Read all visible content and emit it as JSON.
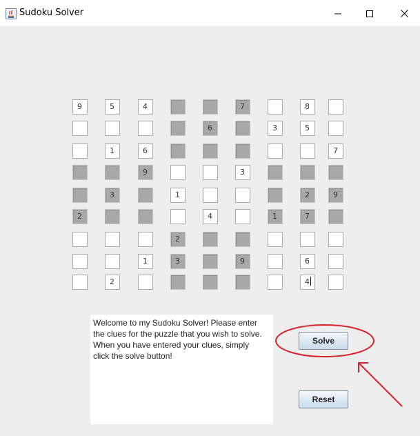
{
  "window": {
    "title": "Sudoku Solver",
    "icon": "java-app-icon",
    "controls": [
      "minimize-icon",
      "maximize-icon",
      "close-icon"
    ]
  },
  "grid": [
    [
      {
        "v": "9",
        "g": false
      },
      {
        "v": "5",
        "g": false
      },
      {
        "v": "4",
        "g": false
      },
      {
        "v": "",
        "g": true
      },
      {
        "v": "",
        "g": true
      },
      {
        "v": "7",
        "g": true
      },
      {
        "v": "",
        "g": false
      },
      {
        "v": "8",
        "g": false
      },
      {
        "v": "",
        "g": false
      }
    ],
    [
      {
        "v": "",
        "g": false
      },
      {
        "v": "",
        "g": false
      },
      {
        "v": "",
        "g": false
      },
      {
        "v": "",
        "g": true
      },
      {
        "v": "6",
        "g": true
      },
      {
        "v": "",
        "g": true
      },
      {
        "v": "3",
        "g": false
      },
      {
        "v": "5",
        "g": false
      },
      {
        "v": "",
        "g": false
      }
    ],
    [
      {
        "v": "",
        "g": false
      },
      {
        "v": "1",
        "g": false
      },
      {
        "v": "6",
        "g": false
      },
      {
        "v": "",
        "g": true
      },
      {
        "v": "",
        "g": true
      },
      {
        "v": "",
        "g": true
      },
      {
        "v": "",
        "g": false
      },
      {
        "v": "",
        "g": false
      },
      {
        "v": "7",
        "g": false
      }
    ],
    [
      {
        "v": "",
        "g": true
      },
      {
        "v": "",
        "g": true
      },
      {
        "v": "9",
        "g": true
      },
      {
        "v": "",
        "g": false
      },
      {
        "v": "",
        "g": false
      },
      {
        "v": "3",
        "g": false
      },
      {
        "v": "",
        "g": true
      },
      {
        "v": "",
        "g": true
      },
      {
        "v": "",
        "g": true
      }
    ],
    [
      {
        "v": "",
        "g": true
      },
      {
        "v": "3",
        "g": true
      },
      {
        "v": "",
        "g": true
      },
      {
        "v": "1",
        "g": false
      },
      {
        "v": "",
        "g": false
      },
      {
        "v": "",
        "g": false
      },
      {
        "v": "",
        "g": true
      },
      {
        "v": "2",
        "g": true
      },
      {
        "v": "9",
        "g": true
      }
    ],
    [
      {
        "v": "2",
        "g": true
      },
      {
        "v": "",
        "g": true
      },
      {
        "v": "",
        "g": true
      },
      {
        "v": "",
        "g": false
      },
      {
        "v": "4",
        "g": false
      },
      {
        "v": "",
        "g": false
      },
      {
        "v": "1",
        "g": true
      },
      {
        "v": "7",
        "g": true
      },
      {
        "v": "",
        "g": true
      }
    ],
    [
      {
        "v": "",
        "g": false
      },
      {
        "v": "",
        "g": false
      },
      {
        "v": "",
        "g": false
      },
      {
        "v": "2",
        "g": true
      },
      {
        "v": "",
        "g": true
      },
      {
        "v": "",
        "g": true
      },
      {
        "v": "",
        "g": false
      },
      {
        "v": "",
        "g": false
      },
      {
        "v": "",
        "g": false
      }
    ],
    [
      {
        "v": "",
        "g": false
      },
      {
        "v": "",
        "g": false
      },
      {
        "v": "1",
        "g": false
      },
      {
        "v": "3",
        "g": true
      },
      {
        "v": "",
        "g": true
      },
      {
        "v": "9",
        "g": true
      },
      {
        "v": "",
        "g": false
      },
      {
        "v": "6",
        "g": false
      },
      {
        "v": "",
        "g": false
      }
    ],
    [
      {
        "v": "",
        "g": false
      },
      {
        "v": "2",
        "g": false
      },
      {
        "v": "",
        "g": false
      },
      {
        "v": "",
        "g": true
      },
      {
        "v": "",
        "g": true
      },
      {
        "v": "",
        "g": true
      },
      {
        "v": "",
        "g": false
      },
      {
        "v": "4",
        "g": false,
        "caret": true
      },
      {
        "v": "",
        "g": false
      }
    ]
  ],
  "message": {
    "text": "Welcome to my Sudoku Solver! Please enter\nthe clues for the puzzle that you wish to solve.\nWhen you have entered your clues, simply\nclick the solve button!"
  },
  "buttons": {
    "solve_label": "Solve",
    "reset_label": "Reset"
  },
  "colors": {
    "window_bg": "#eeeeee",
    "cell_white": "#ffffff",
    "cell_gray": "#a8a8a8",
    "annotation_red": "#d9232e"
  },
  "annotations": [
    "red-circle-around-solve",
    "red-arrow-pointing-to-solve"
  ]
}
